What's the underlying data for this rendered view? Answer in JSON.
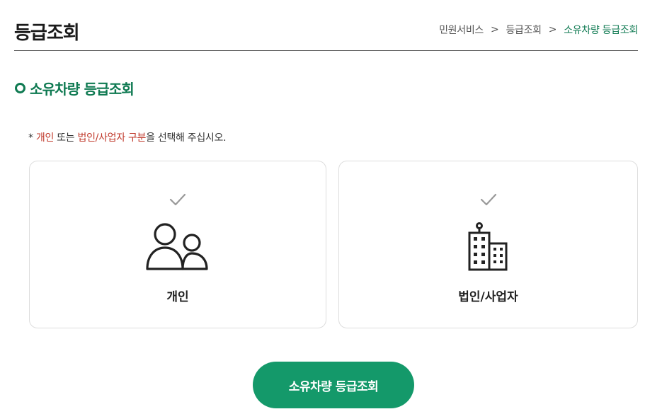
{
  "header": {
    "title": "등급조회",
    "breadcrumb": [
      {
        "label": "민원서비스"
      },
      {
        "label": "등급조회"
      },
      {
        "label": "소유차량 등급조회"
      }
    ],
    "separator": ">"
  },
  "section": {
    "title": "소유차량 등급조회"
  },
  "notice": {
    "prefix": "* ",
    "highlight1": "개인",
    "middle": " 또는 ",
    "highlight2": "법인/사업자 구분",
    "suffix": "을 선택해 주십시오."
  },
  "options": [
    {
      "label": "개인",
      "icon": "people-icon",
      "selected": false
    },
    {
      "label": "법인/사업자",
      "icon": "building-icon",
      "selected": false
    }
  ],
  "submit": {
    "label": "소유차량 등급조회"
  },
  "colors": {
    "accent": "#0f7a52",
    "button": "#14996a",
    "highlight": "#c0392b"
  }
}
